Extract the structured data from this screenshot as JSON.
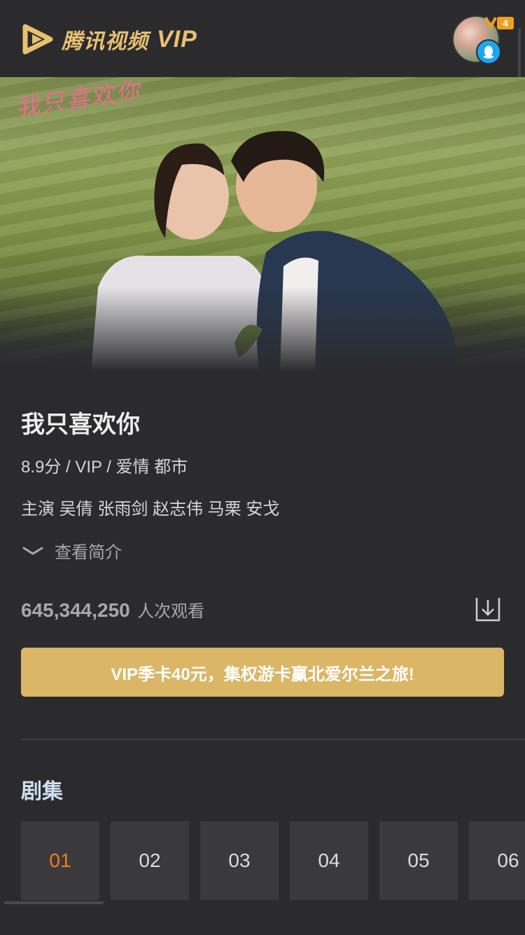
{
  "header": {
    "brand": "腾讯视频",
    "brand_vip": "VIP",
    "vip_level": "4"
  },
  "hero": {
    "art_title": "我只喜欢你"
  },
  "show": {
    "title": "我只喜欢你",
    "meta": "8.9分 / VIP / 爱情 都市",
    "cast": "主演 吴倩 张雨剑 赵志伟 马栗 安戈",
    "intro_label": "查看简介",
    "views_count": "645,344,250",
    "views_label": "人次观看"
  },
  "promo": {
    "text": "VIP季卡40元，集权游卡赢北爱尔兰之旅!"
  },
  "episodes": {
    "section_title": "剧集",
    "items": [
      "01",
      "02",
      "03",
      "04",
      "05",
      "06"
    ],
    "active_index": 0
  },
  "colors": {
    "background": "#2b2b2e",
    "accent_gold": "#dab666",
    "active_episode": "#f07c18",
    "qq_blue": "#1aa7f0"
  },
  "icons": {
    "logo": "tencent-video-play-icon",
    "intro_toggle": "chevron-down-icon",
    "download": "download-icon",
    "qq": "qq-penguin-icon"
  }
}
